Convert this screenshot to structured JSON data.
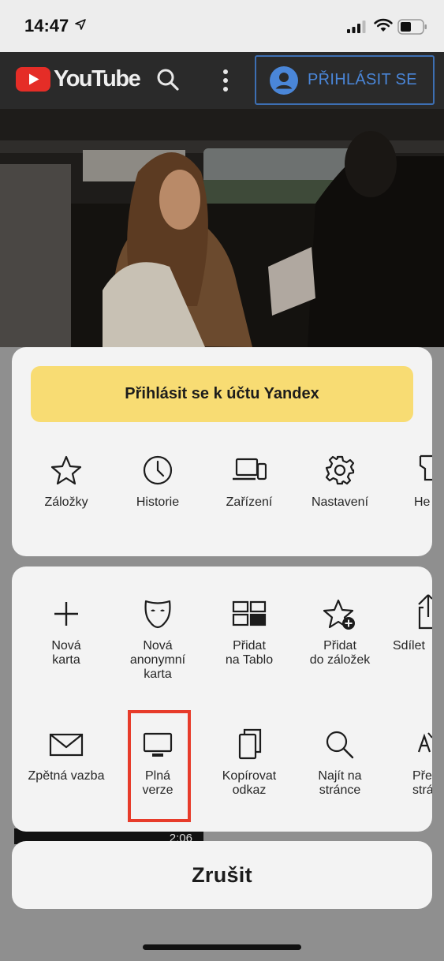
{
  "status_bar": {
    "time": "14:47"
  },
  "youtube": {
    "logo_text": "YouTube",
    "signin_label": "PŘIHLÁSIT SE"
  },
  "background": {
    "video_duration": "2:06"
  },
  "sheet": {
    "yandex_button": "Přihlásit se k účtu Yandex",
    "top_row": [
      {
        "label": "Záložky",
        "icon": "star-icon"
      },
      {
        "label": "Historie",
        "icon": "clock-icon"
      },
      {
        "label": "Zařízení",
        "icon": "devices-icon"
      },
      {
        "label": "Nastavení",
        "icon": "gear-icon"
      },
      {
        "label": "He",
        "icon": "help-icon"
      }
    ],
    "middle_row": [
      {
        "label": "Nová\nkarta",
        "icon": "plus-icon"
      },
      {
        "label": "Nová\nanonymní\nkarta",
        "icon": "mask-icon"
      },
      {
        "label": "Přidat\nna Tablo",
        "icon": "tablo-icon"
      },
      {
        "label": "Přidat\ndo záložek",
        "icon": "star-add-icon"
      },
      {
        "label": "Sdílet",
        "icon": "share-icon"
      }
    ],
    "bottom_row": [
      {
        "label": "Zpětná vazba",
        "icon": "envelope-icon"
      },
      {
        "label": "Plná\nverze",
        "icon": "desktop-icon"
      },
      {
        "label": "Kopírovat\nodkaz",
        "icon": "copy-icon"
      },
      {
        "label": "Najít na\nstránce",
        "icon": "search-icon"
      },
      {
        "label": "Přel\nstrá",
        "icon": "translate-icon"
      }
    ],
    "cancel_label": "Zrušit"
  },
  "colors": {
    "yandex_yellow": "#f8dc73",
    "highlight_red": "#e73b2a",
    "yt_red": "#e52d27",
    "signin_blue": "#4a86d8"
  }
}
